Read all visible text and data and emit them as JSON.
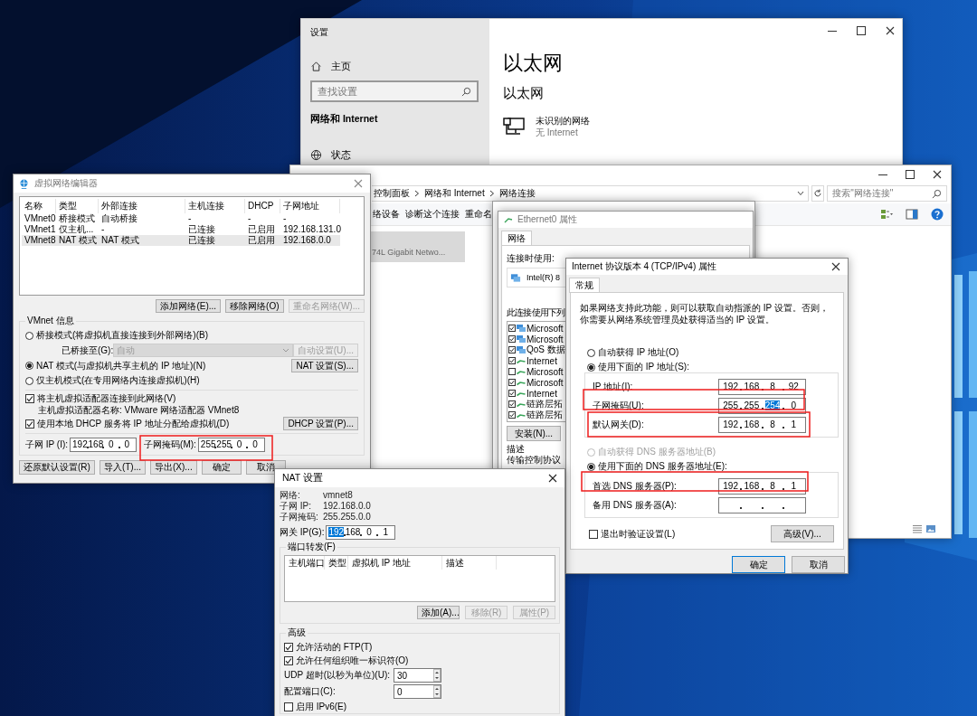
{
  "settings_window": {
    "title": "设置",
    "nav_home": "主页",
    "search": {
      "placeholder": "查找设置"
    },
    "section": "网络和 Internet",
    "nav_items": [
      {
        "label": "状态"
      }
    ],
    "heading": "以太网",
    "subheading": "以太网",
    "network": {
      "name": "未识别的网络",
      "status": "无 Internet"
    }
  },
  "explorer_window": {
    "breadcrumb": [
      "控制面板",
      "网络和 Internet",
      "网络连接"
    ],
    "search": {
      "placeholder": "搜索\"网络连接\""
    },
    "toolbar": [
      "络设备",
      "诊断这个连接",
      "重命名"
    ],
    "adapter": {
      "detail": "74L Gigabit Netwo...",
      "selected": true
    }
  },
  "properties_window": {
    "title": "Ethernet0 属性",
    "tabs": [
      {
        "label": "网络",
        "selected": true
      }
    ],
    "connect_using_label": "连接时使用:",
    "adapter": "Intel(R) 8",
    "items_label": "此连接使用下列",
    "items": [
      {
        "label": "Microsoft",
        "checked": true,
        "kind": "service"
      },
      {
        "label": "Microsoft",
        "checked": true,
        "kind": "service"
      },
      {
        "label": "QoS 数据",
        "checked": true,
        "kind": "service"
      },
      {
        "label": "Internet",
        "checked": true,
        "kind": "protocol"
      },
      {
        "label": "Microsoft",
        "checked": false,
        "kind": "protocol"
      },
      {
        "label": "Microsoft",
        "checked": true,
        "kind": "protocol"
      },
      {
        "label": "Internet",
        "checked": true,
        "kind": "protocol"
      },
      {
        "label": "链路层拓",
        "checked": true,
        "kind": "protocol"
      },
      {
        "label": "链路层拓",
        "checked": true,
        "kind": "protocol"
      }
    ],
    "install_button": "安装(N)...",
    "description_label": "描述",
    "description": "传输控制协议"
  },
  "ipv4_window": {
    "title": "Internet 协议版本 4 (TCP/IPv4) 属性",
    "tabs": [
      {
        "label": "常规",
        "selected": true
      }
    ],
    "intro": "如果网络支持此功能，则可以获取自动指派的 IP 设置。否则，你需要从网络系统管理员处获得适当的 IP 设置。",
    "ip_modes": [
      {
        "label": "自动获得 IP 地址(O)",
        "selected": false,
        "disabled": false
      },
      {
        "label": "使用下面的 IP 地址(S):",
        "selected": true,
        "disabled": false
      }
    ],
    "ip_fields": [
      {
        "label": "IP 地址(I):",
        "octets": [
          {
            "text": "192",
            "selected": false
          },
          {
            "text": "168",
            "selected": false
          },
          {
            "text": "8",
            "selected": false
          },
          {
            "text": "92",
            "selected": false
          }
        ]
      },
      {
        "label": "子网掩码(U):",
        "octets": [
          {
            "text": "255",
            "selected": false
          },
          {
            "text": "255",
            "selected": false
          },
          {
            "text": "254",
            "selected": true
          },
          {
            "text": "0",
            "selected": false
          }
        ]
      },
      {
        "label": "默认网关(D):",
        "octets": [
          {
            "text": "192",
            "selected": false
          },
          {
            "text": "168",
            "selected": false
          },
          {
            "text": "8",
            "selected": false
          },
          {
            "text": "1",
            "selected": false
          }
        ]
      }
    ],
    "dns_modes": [
      {
        "label": "自动获得 DNS 服务器地址(B)",
        "selected": false,
        "disabled": true
      },
      {
        "label": "使用下面的 DNS 服务器地址(E):",
        "selected": true,
        "disabled": false
      }
    ],
    "dns_fields": [
      {
        "label": "首选 DNS 服务器(P):",
        "octets": [
          {
            "text": "192",
            "selected": false
          },
          {
            "text": "168",
            "selected": false
          },
          {
            "text": "8",
            "selected": false
          },
          {
            "text": "1",
            "selected": false
          }
        ]
      },
      {
        "label": "备用 DNS 服务器(A):"
      }
    ],
    "validate": {
      "label": "退出时验证设置(L)",
      "checked": false
    },
    "advanced_button": "高级(V)...",
    "buttons": [
      {
        "label": "确定",
        "default": true
      },
      {
        "label": "取消",
        "default": false
      }
    ]
  },
  "vne_window": {
    "title": "虚拟网络编辑器",
    "columns": [
      "名称",
      "类型",
      "外部连接",
      "主机连接",
      "DHCP",
      "子网地址"
    ],
    "rows": [
      {
        "cells": [
          "VMnet0",
          "桥接模式",
          "自动桥接",
          "-",
          "-",
          "-"
        ],
        "selected": false
      },
      {
        "cells": [
          "VMnet1",
          "仅主机...",
          "-",
          "已连接",
          "已启用",
          "192.168.131.0"
        ],
        "selected": false
      },
      {
        "cells": [
          "VMnet8",
          "NAT 模式",
          "NAT 模式",
          "已连接",
          "已启用",
          "192.168.0.0"
        ],
        "selected": true
      }
    ],
    "table_buttons": [
      {
        "label": "添加网络(E)...",
        "disabled": false
      },
      {
        "label": "移除网络(O)",
        "disabled": false
      },
      {
        "label": "重命名网络(W)...",
        "disabled": true
      }
    ],
    "info_title": "VMnet 信息",
    "bridge_mode": {
      "label": "桥接模式(将虚拟机直接连接到外部网络)(B)",
      "selected": false
    },
    "bridge_to": {
      "label": "已桥接至(G):",
      "value": "自动",
      "disabled": true
    },
    "auto_button": {
      "label": "自动设置(U)...",
      "disabled": true
    },
    "nat_mode": {
      "label": "NAT 模式(与虚拟机共享主机的 IP 地址)(N)",
      "selected": true
    },
    "nat_button": "NAT 设置(S)...",
    "host_mode": {
      "label": "仅主机模式(在专用网络内连接虚拟机)(H)",
      "selected": false
    },
    "connect_adapter": {
      "label": "将主机虚拟适配器连接到此网络(V)",
      "checked": true
    },
    "adapter_name": "主机虚拟适配器名称: VMware 网络适配器 VMnet8",
    "use_dhcp": {
      "label": "使用本地 DHCP 服务将 IP 地址分配给虚拟机(D)",
      "checked": true
    },
    "dhcp_button": "DHCP 设置(P)...",
    "subnet_ip": {
      "label": "子网 IP (I):",
      "octets": [
        "192",
        "168",
        "0",
        "0"
      ]
    },
    "subnet_mask": {
      "label": "子网掩码(M):",
      "octets": [
        "255",
        "255",
        "0",
        "0"
      ]
    },
    "footer_buttons": [
      "还原默认设置(R)",
      "导入(T)...",
      "导出(X)...",
      "确定",
      "取消"
    ]
  },
  "nat_window": {
    "title": "NAT 设置",
    "info": [
      {
        "label": "网络:",
        "value": "vmnet8"
      },
      {
        "label": "子网 IP:",
        "value": "192.168.0.0"
      },
      {
        "label": "子网掩码:",
        "value": "255.255.0.0"
      }
    ],
    "gateway": {
      "label": "网关 IP(G):",
      "octets": [
        {
          "text": "192",
          "selected": true
        },
        {
          "text": "168",
          "selected": false
        },
        {
          "text": "0",
          "selected": false
        },
        {
          "text": "1",
          "selected": false
        }
      ]
    },
    "port_forwarding": {
      "title": "端口转发(F)",
      "columns": [
        "主机端口",
        "类型",
        "虚拟机 IP 地址",
        "描述"
      ],
      "buttons": [
        {
          "label": "添加(A)...",
          "disabled": false
        },
        {
          "label": "移除(R)",
          "disabled": true
        },
        {
          "label": "属性(P)",
          "disabled": true
        }
      ]
    },
    "advanced": {
      "title": "高级",
      "options": [
        {
          "label": "允许活动的 FTP(T)",
          "checked": true
        },
        {
          "label": "允许任何组织唯一标识符(O)",
          "checked": true
        }
      ],
      "spinners": [
        {
          "label": "UDP 超时(以秒为单位)(U):",
          "value": "30"
        },
        {
          "label": "配置端口(C):",
          "value": "0"
        }
      ],
      "ipv6": {
        "label": "启用 IPv6(E)",
        "checked": false
      }
    }
  }
}
